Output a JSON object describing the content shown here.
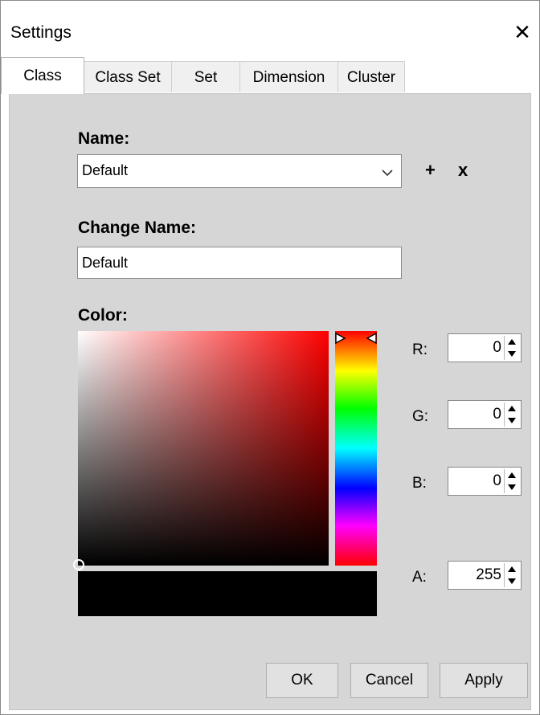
{
  "window": {
    "title": "Settings",
    "close_glyph": "✕"
  },
  "tabs": [
    {
      "label": "Class",
      "active": true
    },
    {
      "label": "Class Set",
      "active": false
    },
    {
      "label": "Set",
      "active": false
    },
    {
      "label": "Dimension",
      "active": false
    },
    {
      "label": "Cluster",
      "active": false
    }
  ],
  "name_section": {
    "label": "Name:",
    "selected": "Default",
    "add_glyph": "+",
    "remove_glyph": "x"
  },
  "change_name": {
    "label": "Change Name:",
    "value": "Default"
  },
  "color": {
    "label": "Color:",
    "hue_color": "#ff0000",
    "preview_color": "#000000",
    "channels": [
      {
        "label": "R:",
        "value": "0"
      },
      {
        "label": "G:",
        "value": "0"
      },
      {
        "label": "B:",
        "value": "0"
      },
      {
        "label": "A:",
        "value": "255"
      }
    ]
  },
  "buttons": {
    "ok": "OK",
    "cancel": "Cancel",
    "apply": "Apply"
  },
  "icons": [
    "close-icon",
    "chevron-down-icon",
    "plus-icon",
    "remove-icon",
    "spin-up-icon",
    "spin-down-icon"
  ]
}
